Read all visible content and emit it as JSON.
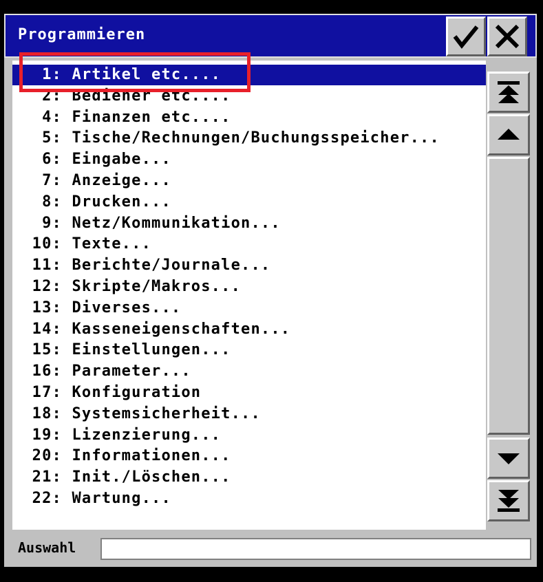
{
  "window": {
    "title": "Programmieren",
    "ok_symbol": "✓",
    "cancel_symbol": "✕"
  },
  "menu": {
    "items": [
      {
        "num": "1:",
        "label": "Artikel etc...."
      },
      {
        "num": "2:",
        "label": "Bediener etc...."
      },
      {
        "num": "4:",
        "label": "Finanzen etc...."
      },
      {
        "num": "5:",
        "label": "Tische/Rechnungen/Buchungsspeicher..."
      },
      {
        "num": "6:",
        "label": "Eingabe..."
      },
      {
        "num": "7:",
        "label": "Anzeige..."
      },
      {
        "num": "8:",
        "label": "Drucken..."
      },
      {
        "num": "9:",
        "label": "Netz/Kommunikation..."
      },
      {
        "num": "10:",
        "label": "Texte..."
      },
      {
        "num": "11:",
        "label": "Berichte/Journale..."
      },
      {
        "num": "12:",
        "label": "Skripte/Makros..."
      },
      {
        "num": "13:",
        "label": "Diverses..."
      },
      {
        "num": "14:",
        "label": "Kasseneigenschaften..."
      },
      {
        "num": "15:",
        "label": "Einstellungen..."
      },
      {
        "num": "16:",
        "label": "Parameter..."
      },
      {
        "num": "17:",
        "label": "Konfiguration"
      },
      {
        "num": "18:",
        "label": "Systemsicherheit..."
      },
      {
        "num": "19:",
        "label": "Lizenzierung..."
      },
      {
        "num": "20:",
        "label": "Informationen..."
      },
      {
        "num": "21:",
        "label": "Init./Löschen..."
      },
      {
        "num": "22:",
        "label": "Wartung..."
      }
    ],
    "selected_index": 0
  },
  "scrollbar": {
    "icons": [
      "scroll-top-icon",
      "scroll-up-icon",
      "scroll-down-icon",
      "scroll-bottom-icon"
    ]
  },
  "input": {
    "label": "Auswahl",
    "value": ""
  },
  "colors": {
    "titlebar": "#1010a0",
    "selection": "#1010a0",
    "highlight_box": "#e8202a"
  }
}
